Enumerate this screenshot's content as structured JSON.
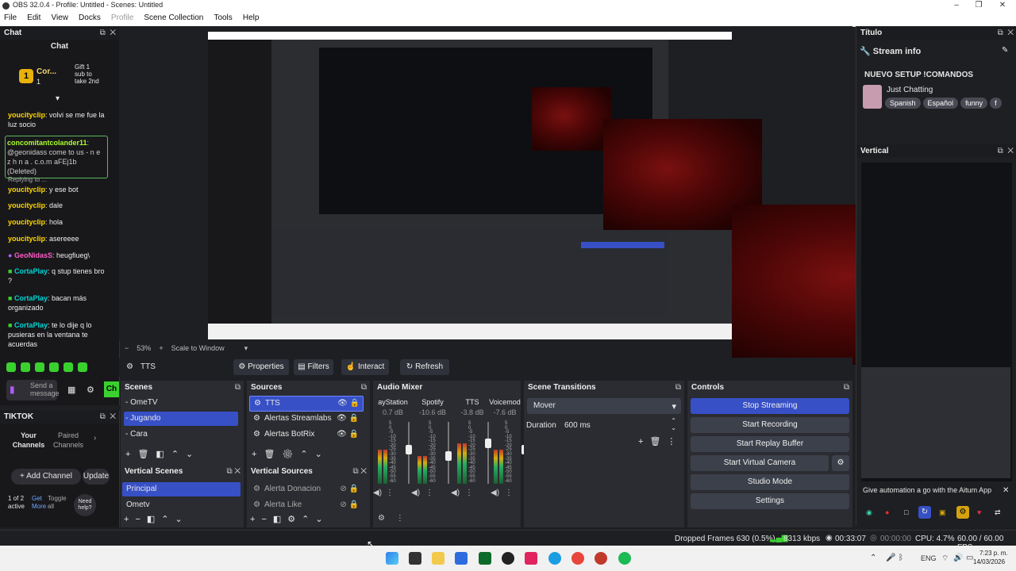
{
  "window": {
    "title": "OBS 32.0.4 - Profile: Untitled - Scenes: Untitled"
  },
  "menu": [
    "File",
    "Edit",
    "View",
    "Docks",
    "Profile",
    "Scene Collection",
    "Tools",
    "Help"
  ],
  "chat": {
    "dock_title": "Chat",
    "header": "Chat",
    "gift_user": "Cor...",
    "gift_count": "1",
    "gift_text": "Gift 1 sub to take 2nd",
    "messages": [
      {
        "user": "youcityclip",
        "text": ": volvi se me fue la luz socio"
      },
      {
        "user": "concomitantcolander11",
        "text": ": @geonidass come to us - n e z h n a . c.o.m aFEj1b (Deleted)"
      },
      {
        "user": "Replying to ...",
        "text": ""
      },
      {
        "user": "youcityclip",
        "text": ": y ese bot"
      },
      {
        "user": "youcityclip",
        "text": ": dale"
      },
      {
        "user": "youcityclip",
        "text": ": hola"
      },
      {
        "user": "youcityclip",
        "text": ": asereeee"
      },
      {
        "user": "GeoNidasS",
        "text": ": heugfiueg\\"
      },
      {
        "user": "CortaPlay",
        "text": ": q stup tienes bro ?"
      },
      {
        "user": "CortaPlay",
        "text": ": bacan más organizado"
      },
      {
        "user": "CortaPlay",
        "text": ": te lo dije q lo pusieras en la ventana te acuerdas"
      }
    ],
    "input_placeholder": "Send a message",
    "send_label": "Ch"
  },
  "tiktok": {
    "dock_title": "TIKTOK",
    "tab_your": "Your Channels",
    "tab_paired": "Paired Channels",
    "add_channel": "Add Channel",
    "update": "Update",
    "pager": "1 of 2 active",
    "get_more": "Get More",
    "toggle_all": "Toggle all",
    "need_help": "Need help?"
  },
  "preview": {
    "zoom": "53%",
    "scale_mode": "Scale to Window"
  },
  "source_toolbar": {
    "selected_source": "TTS",
    "properties": "Properties",
    "filters": "Filters",
    "interact": "Interact",
    "refresh": "Refresh"
  },
  "scenes": {
    "title": "Scenes",
    "items": [
      "- OmeTV",
      "- Jugando",
      "- Cara"
    ]
  },
  "sources": {
    "title": "Sources",
    "items": [
      "TTS",
      "Alertas Streamlabs",
      "Alertas BotRix"
    ]
  },
  "vertical_scenes": {
    "title": "Vertical Scenes",
    "items": [
      "Principal",
      "Ometv"
    ]
  },
  "vertical_sources": {
    "title": "Vertical Sources",
    "items": [
      "Alerta Donacion",
      "Alerta Like"
    ]
  },
  "mixer": {
    "title": "Audio Mixer",
    "channels": [
      {
        "name": "ayStation",
        "db": "0.7 dB",
        "level": 0.55
      },
      {
        "name": "Spotify",
        "db": "-10.6 dB",
        "level": 0.45
      },
      {
        "name": "TTS",
        "db": "-3.8 dB",
        "level": 0.65
      },
      {
        "name": "Voicemod",
        "db": "-7.6 dB",
        "level": 0.55
      }
    ],
    "scale": [
      "5",
      "0",
      "-5",
      "-10",
      "-15",
      "-20",
      "-25",
      "-30",
      "-35",
      "-40",
      "-45",
      "-50",
      "-55",
      "-60"
    ]
  },
  "transitions": {
    "title": "Scene Transitions",
    "transition": "Mover",
    "duration_label": "Duration",
    "duration": "600 ms"
  },
  "controls": {
    "title": "Controls",
    "stop_streaming": "Stop Streaming",
    "start_recording": "Start Recording",
    "start_replay": "Start Replay Buffer",
    "start_virtual": "Start Virtual Camera",
    "studio_mode": "Studio Mode",
    "settings": "Settings"
  },
  "right": {
    "titulo": "Título",
    "stream_info": "Stream info",
    "stream_title": "NUEVO SETUP !COMANDOS",
    "category": "Just Chatting",
    "tags": [
      "Spanish",
      "Español",
      "funny",
      "f"
    ],
    "vertical": "Vertical",
    "aitum": "Give automation a go with the Aitum App"
  },
  "status": {
    "dropped": "Dropped Frames 630 (0.5%)",
    "bitrate": "8313 kbps",
    "stream_time": "00:33:07",
    "rec_time": "00:00:00",
    "cpu": "CPU: 4.7%",
    "fps": "60.00 / 60.00 FPS"
  },
  "taskbar": {
    "lang": "ENG",
    "time": "7:23 p. m.",
    "date": "14/03/2026"
  }
}
